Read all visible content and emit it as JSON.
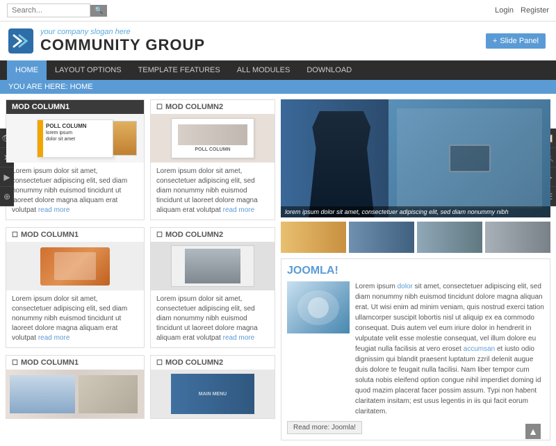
{
  "search": {
    "placeholder": "Search...",
    "button_label": "🔍"
  },
  "top_links": {
    "login": "Login",
    "register": "Register"
  },
  "header": {
    "slogan": "your company slogan here",
    "brand_name": "COMMUNITY GROUP",
    "slide_panel_btn": "Slide Panel"
  },
  "nav": {
    "items": [
      {
        "label": "HOME",
        "active": true
      },
      {
        "label": "LAYOUT OPTIONS",
        "active": false
      },
      {
        "label": "TEMPLATE FEATURES",
        "active": false
      },
      {
        "label": "ALL MODULES",
        "active": false
      },
      {
        "label": "DOWNLOAD",
        "active": false
      }
    ]
  },
  "breadcrumb": "YOU ARE HERE: HOME",
  "col1": {
    "modules": [
      {
        "header": "MOD COLUMN1",
        "dark": true,
        "text": "Lorem ipsum dolor sit amet, consectetuer adipiscing elit, sed diam nonummy nibh euismod tincidunt ut laoreet dolore magna aliquam erat volutpat",
        "read_more": "read more"
      },
      {
        "header": "MOD COLUMN1",
        "dark": false,
        "text": "Lorem ipsum dolor sit amet, consectetuer adipiscing elit, sed diam nonummy nibh euismod tincidunt ut laoreet dolore magna aliquam erat volutpat",
        "read_more": "read more"
      },
      {
        "header": "MOD COLUMN1",
        "dark": false,
        "text": "",
        "read_more": ""
      }
    ]
  },
  "col2": {
    "modules": [
      {
        "header": "MOD COLUMN2",
        "dark": false,
        "text": "Lorem ipsum dolor sit amet, consectetuer adipiscing elit, sed diam nonummy nibh euismod tincidunt ut laoreet dolore magna aliquam erat volutpat",
        "read_more": "read more"
      },
      {
        "header": "MOD COLUMN2",
        "dark": false,
        "text": "Lorem ipsum dolor sit amet, consectetuer adipiscing elit, sed diam nonummy nibh euismod tincidunt ut laoreet dolore magna aliquam erat volutpat",
        "read_more": "read more"
      },
      {
        "header": "MOD COLUMN2",
        "dark": false,
        "text": "",
        "read_more": ""
      }
    ]
  },
  "hero": {
    "caption": "lorem ipsum dolor sit amet, consectetuer adipiscing elit, sed diam nonummy nibh"
  },
  "joomla": {
    "title": "JOOMLA!",
    "text_part1": "Lorem ipsum ",
    "dolor_link": "dolor",
    "text_part2": " sit amet, consectetuer adipiscing elit, sed diam nonummy nibh euismod tincidunt dolore magna aliquan erat. Ut wisi enim ad minim veniam, quis nostrud exerci tation ullamcorper suscipit lobortis nisl ut aliquip ex ea commodo consequat. Duis autem vel eum iriure dolor in hendrerit in vulputate velit esse molestie consequat, vel illum dolore eu feugiat nulla facilisis at vero eroset ",
    "accumsan_link": "accumsan",
    "text_part3": " et iusto odio dignissim qui blandit praesent luptatum zzril delenit augue duis dolore te feugait nulla facilisi. Nam liber tempor cum soluta nobis eleifend option congue nihil imperdiet doming id quod mazim placerat facer possim assum. Typi non habent claritatem insitam; est usus legentis in iis qui facit eorum claritatem.",
    "read_more_btn": "Read more: Joomla!"
  },
  "side_icons_left": [
    "👁",
    "✕",
    "▶",
    "⊕"
  ],
  "side_icons_right": [
    "📋",
    "🔍",
    "▶",
    "☰"
  ],
  "scroll_top": "▲"
}
